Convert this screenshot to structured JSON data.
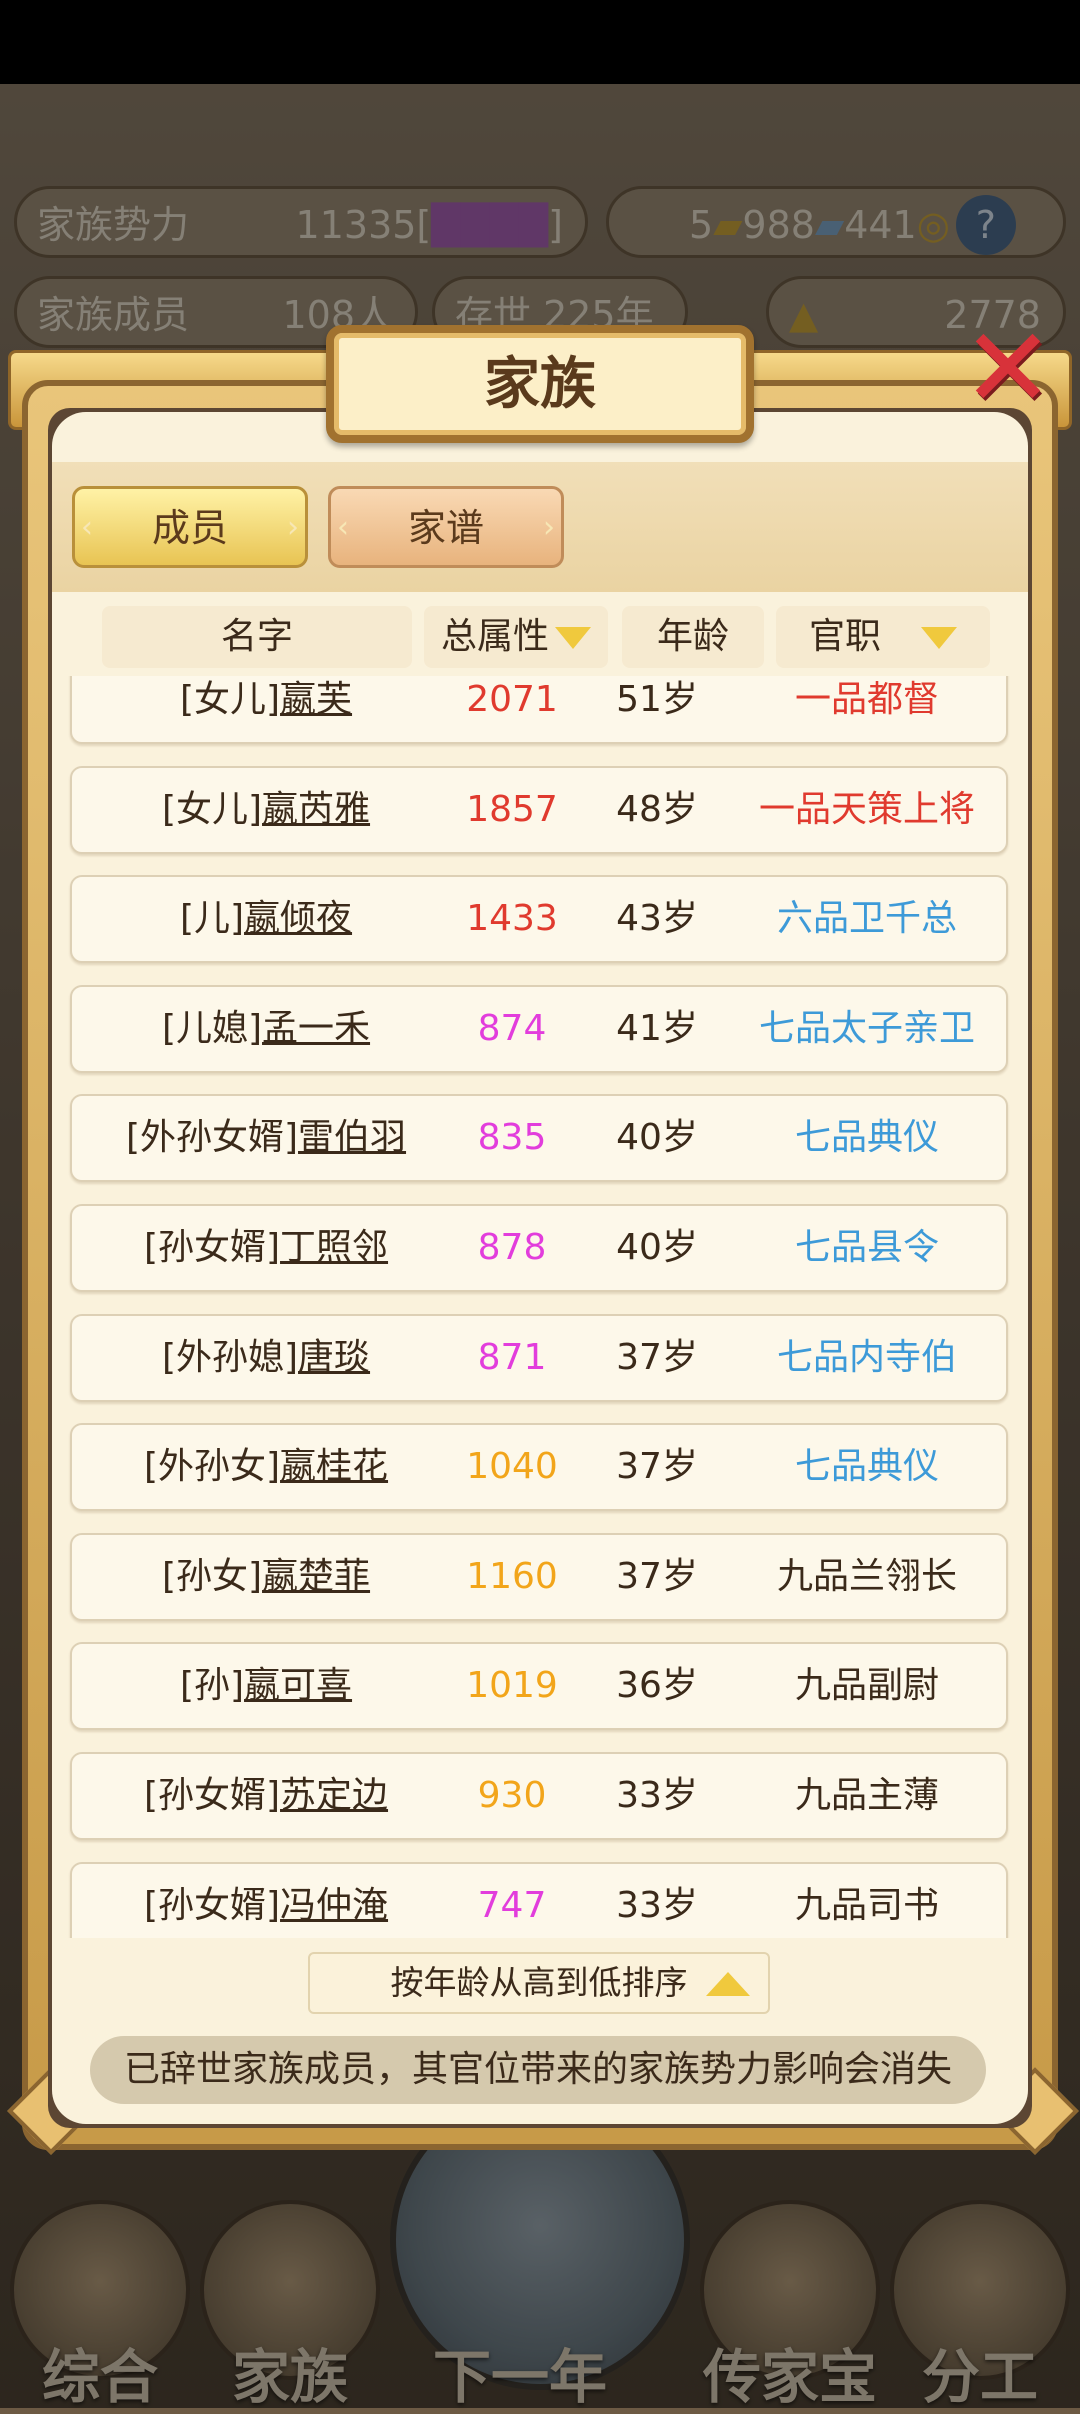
{
  "background": {
    "stats": {
      "power_label": "家族势力",
      "power_value": "11335[",
      "power_rank": "████",
      "power_suffix": "]",
      "resource_a": "5",
      "resource_b": "988",
      "resource_c": "441",
      "members_label": "家族成员",
      "members_value": "108人",
      "alive_text": "存世 225年",
      "gold": "2778"
    },
    "nav": [
      "综合",
      "家族",
      "下一年",
      "传家宝",
      "分工"
    ]
  },
  "modal": {
    "title": "家族",
    "close_icon": "close-x-icon",
    "tabs": [
      {
        "label": "成员",
        "active": true
      },
      {
        "label": "家谱",
        "active": false
      }
    ],
    "columns": {
      "name": "名字",
      "attr": "总属性",
      "age": "年龄",
      "rank": "官职"
    },
    "rows": [
      {
        "relation": "[女儿]",
        "name": "嬴芙",
        "attr": "2071",
        "attr_color": "#e03a2e",
        "age": "51岁",
        "rank": "一品都督",
        "rank_color": "#e03a2e"
      },
      {
        "relation": "[女儿]",
        "name": "嬴芮雅",
        "attr": "1857",
        "attr_color": "#e03a2e",
        "age": "48岁",
        "rank": "一品天策上将",
        "rank_color": "#e03a2e"
      },
      {
        "relation": "[儿]",
        "name": "嬴倾夜",
        "attr": "1433",
        "attr_color": "#e03a2e",
        "age": "43岁",
        "rank": "六品卫千总",
        "rank_color": "#3d9ad8"
      },
      {
        "relation": "[儿媳]",
        "name": "孟一禾",
        "attr": "874",
        "attr_color": "#e23ddc",
        "age": "41岁",
        "rank": "七品太子亲卫",
        "rank_color": "#3d9ad8"
      },
      {
        "relation": "[外孙女婿]",
        "name": "雷伯羽",
        "attr": "835",
        "attr_color": "#e23ddc",
        "age": "40岁",
        "rank": "七品典仪",
        "rank_color": "#3d9ad8"
      },
      {
        "relation": "[孙女婿]",
        "name": "丁照邻",
        "attr": "878",
        "attr_color": "#e23ddc",
        "age": "40岁",
        "rank": "七品县令",
        "rank_color": "#3d9ad8"
      },
      {
        "relation": "[外孙媳]",
        "name": "唐琰",
        "attr": "871",
        "attr_color": "#e23ddc",
        "age": "37岁",
        "rank": "七品内寺伯",
        "rank_color": "#3d9ad8"
      },
      {
        "relation": "[外孙女]",
        "name": "嬴桂花",
        "attr": "1040",
        "attr_color": "#f2a51a",
        "age": "37岁",
        "rank": "七品典仪",
        "rank_color": "#3d9ad8"
      },
      {
        "relation": "[孙女]",
        "name": "嬴楚菲",
        "attr": "1160",
        "attr_color": "#f2a51a",
        "age": "37岁",
        "rank": "九品兰翎长",
        "rank_color": "#3b2a1a"
      },
      {
        "relation": "[孙]",
        "name": "嬴可喜",
        "attr": "1019",
        "attr_color": "#f2a51a",
        "age": "36岁",
        "rank": "九品副尉",
        "rank_color": "#3b2a1a"
      },
      {
        "relation": "[孙女婿]",
        "name": "苏定边",
        "attr": "930",
        "attr_color": "#f2a51a",
        "age": "33岁",
        "rank": "九品主薄",
        "rank_color": "#3b2a1a"
      },
      {
        "relation": "[孙女婿]",
        "name": "冯仲淹",
        "attr": "747",
        "attr_color": "#e23ddc",
        "age": "33岁",
        "rank": "九品司书",
        "rank_color": "#3b2a1a"
      }
    ],
    "sort_label": "按年龄从高到低排序",
    "notice": "已辞世家族成员，其官位带来的家族势力影响会消失"
  }
}
